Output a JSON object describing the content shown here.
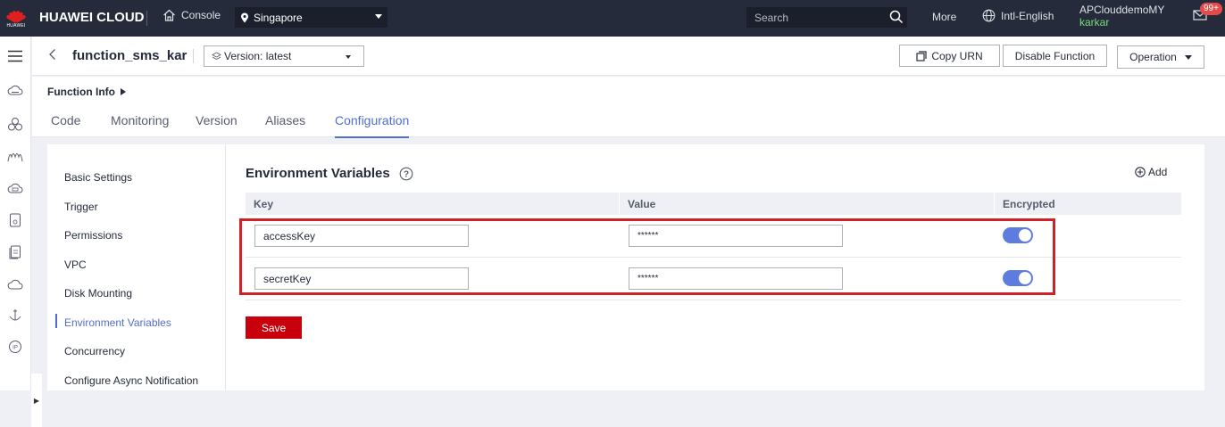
{
  "topbar": {
    "logo_text": "HUAWEI",
    "brand": "HUAWEI CLOUD",
    "console": "Console",
    "region": "Singapore",
    "search_placeholder": "Search",
    "more": "More",
    "language": "Intl-English",
    "account_name": "APClouddemoMY",
    "user_name": "karkar",
    "notifications": "99+",
    "colors": {
      "bar": "#252b3a",
      "user": "#7bdc7b",
      "badge": "#e34b4b"
    }
  },
  "leftnav": {
    "icons": [
      "menu-icon",
      "cloud-server-icon",
      "cluster-icon",
      "function-icon",
      "database-icon",
      "storage-icon",
      "document-icon",
      "cloud-icon",
      "anchor-icon",
      "ip-icon"
    ]
  },
  "header": {
    "function_name": "function_sms_kar",
    "version": "Version: latest",
    "copy_urn": "Copy URN",
    "disable_function": "Disable Function",
    "operation": "Operation"
  },
  "info": {
    "label": "Function Info"
  },
  "tabs": [
    {
      "label": "Code"
    },
    {
      "label": "Monitoring"
    },
    {
      "label": "Version"
    },
    {
      "label": "Aliases"
    },
    {
      "label": "Configuration",
      "active": true
    }
  ],
  "config_nav": [
    {
      "label": "Basic Settings"
    },
    {
      "label": "Trigger"
    },
    {
      "label": "Permissions"
    },
    {
      "label": "VPC"
    },
    {
      "label": "Disk Mounting"
    },
    {
      "label": "Environment Variables",
      "active": true
    },
    {
      "label": "Concurrency"
    },
    {
      "label": "Configure Async Notification"
    }
  ],
  "env": {
    "title": "Environment Variables",
    "add": "Add",
    "columns": {
      "key": "Key",
      "value": "Value",
      "encrypted": "Encrypted"
    },
    "rows": [
      {
        "key": "accessKey",
        "value": "******",
        "encrypted": true
      },
      {
        "key": "secretKey",
        "value": "******",
        "encrypted": true
      }
    ],
    "save": "Save",
    "colors": {
      "accent": "#526ecc",
      "toggle": "#5e7ce0",
      "save": "#c7000b",
      "highlight": "#d02028"
    }
  }
}
